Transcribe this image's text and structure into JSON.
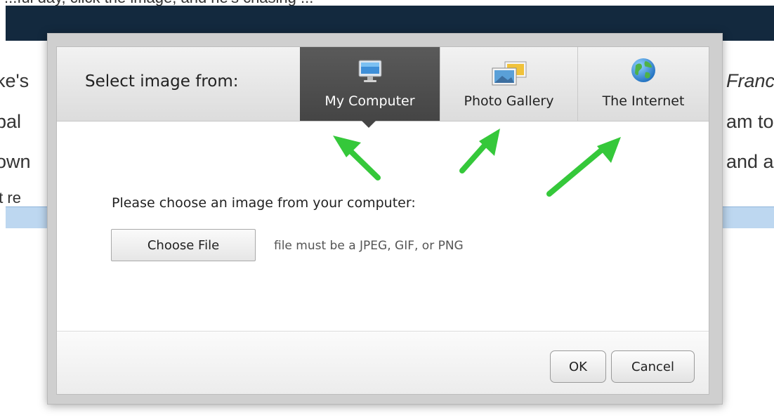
{
  "background": {
    "top_cut_text": "...ful day, click the image, and he's chasing ...",
    "left_lines": [
      "ke's",
      "bal",
      "own",
      "'t re"
    ],
    "right_lines": [
      "Franc",
      "am to",
      "and a"
    ]
  },
  "dialog": {
    "select_label": "Select image from:",
    "tabs": [
      {
        "label": "My Computer",
        "icon": "monitor-icon",
        "active": true
      },
      {
        "label": "Photo Gallery",
        "icon": "photos-icon",
        "active": false
      },
      {
        "label": "The Internet",
        "icon": "globe-icon",
        "active": false
      }
    ],
    "prompt": "Please choose an image from your computer:",
    "choose_button": "Choose File",
    "hint": "file must be a JPEG, GIF, or PNG",
    "ok_button": "OK",
    "cancel_button": "Cancel"
  },
  "colors": {
    "navbar": "#13293e",
    "active_tab": "#4f4f4f",
    "arrow": "#35c83a",
    "blue_band": "#bdd7f0"
  }
}
